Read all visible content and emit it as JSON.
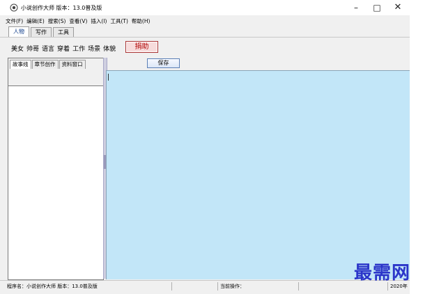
{
  "window": {
    "title": "小说创作大师 版本：13.0普及版",
    "controls": {
      "minimize": "–",
      "maximize": "□",
      "close": "✕"
    }
  },
  "menu": [
    "文件(F)",
    "编辑(E)",
    "搜索(S)",
    "查看(V)",
    "插入(I)",
    "工具(T)",
    "帮助(H)"
  ],
  "main_tabs": [
    {
      "label": "人物",
      "active": true
    },
    {
      "label": "写作",
      "active": false
    },
    {
      "label": "工具",
      "active": false
    }
  ],
  "categories": [
    "美女",
    "帅哥",
    "语言",
    "穿着",
    "工作",
    "场景",
    "体貌"
  ],
  "donate_label": "捐助",
  "left_tabs": [
    {
      "label": "故事线",
      "active": true
    },
    {
      "label": "章节创作",
      "active": false
    },
    {
      "label": "资料窗口",
      "active": false
    }
  ],
  "save_label": "保存",
  "status": {
    "program": "程序名：小说创作大师 版本：13.0普及版",
    "operation": "当前操作：",
    "year": "2020年"
  },
  "watermark": "最需网",
  "colors": {
    "editor_bg": "#c2e6f8",
    "donate_text": "#b00000",
    "watermark": "#2b35c9"
  }
}
